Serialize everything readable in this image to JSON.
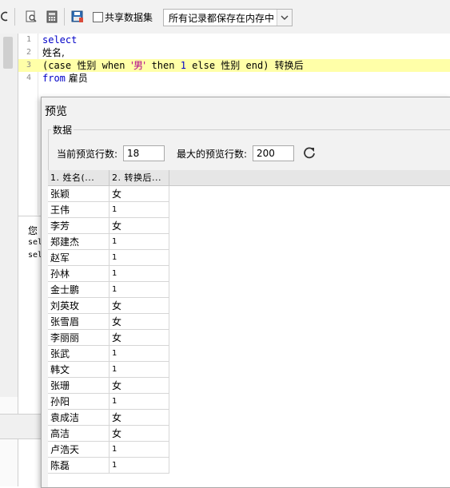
{
  "toolbar": {
    "share_label": "共享数据集",
    "memory_select": "所有记录都保存在内存中"
  },
  "editor": {
    "lines": [
      {
        "n": "1",
        "text": "select"
      },
      {
        "n": "2",
        "text": "姓名,"
      },
      {
        "n": "3",
        "parts": [
          "(case ",
          "性别",
          " when ",
          "'男'",
          " then ",
          "1",
          " else ",
          "性别",
          " end) ",
          "转换后"
        ]
      },
      {
        "n": "4",
        "from": "from",
        "table": " 雇员"
      }
    ]
  },
  "messages": {
    "line1": "您",
    "line2": "sel",
    "line3": "sel"
  },
  "dialog": {
    "title": "预览",
    "group": "数据",
    "current_rows_label": "当前预览行数:",
    "current_rows_value": "18",
    "max_rows_label": "最大的预览行数:",
    "max_rows_value": "200",
    "columns": [
      "1. 姓名(...",
      "2. 转换后..."
    ],
    "rows": [
      [
        "张颖",
        "女"
      ],
      [
        "王伟",
        "1"
      ],
      [
        "李芳",
        "女"
      ],
      [
        "郑建杰",
        "1"
      ],
      [
        "赵军",
        "1"
      ],
      [
        "孙林",
        "1"
      ],
      [
        "金士鹏",
        "1"
      ],
      [
        "刘英玫",
        "女"
      ],
      [
        "张雪眉",
        "女"
      ],
      [
        "李丽丽",
        "女"
      ],
      [
        "张武",
        "1"
      ],
      [
        "韩文",
        "1"
      ],
      [
        "张珊",
        "女"
      ],
      [
        "孙阳",
        "1"
      ],
      [
        "袁成洁",
        "女"
      ],
      [
        "高洁",
        "女"
      ],
      [
        "卢浩天",
        "1"
      ],
      [
        "陈磊",
        "1"
      ]
    ]
  }
}
